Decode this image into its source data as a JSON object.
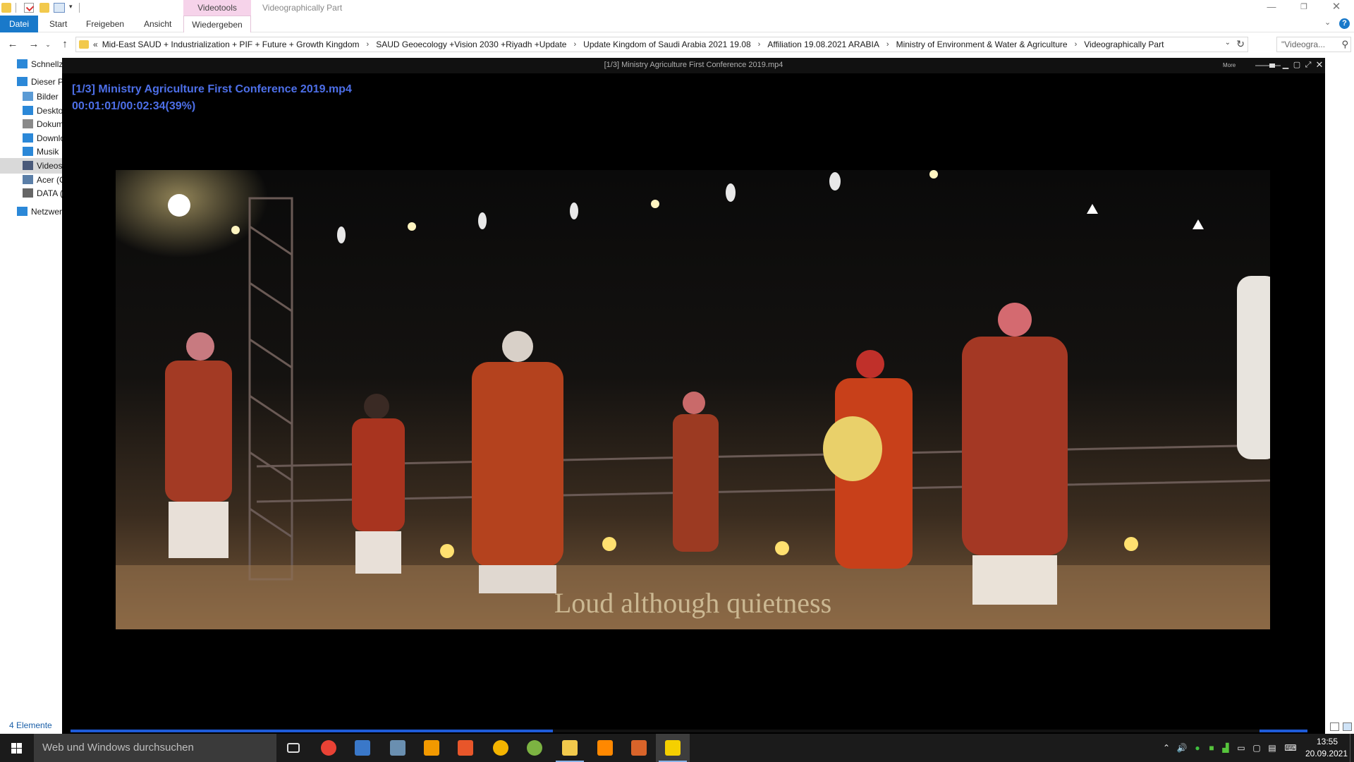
{
  "explorer": {
    "window_title": "Videographically Part",
    "context_tab_header": "Videotools",
    "ribbon_tabs": [
      "Datei",
      "Start",
      "Freigeben",
      "Ansicht",
      "Wiedergeben"
    ],
    "address_overflow": "«",
    "breadcrumbs": [
      "Mid-East SAUD + Industrialization + PIF + Future + Growth Kingdom",
      "SAUD Geoecology +Vision 2030 +Riyadh +Update",
      "Update Kingdom of Saudi Arabia 2021 19.08",
      "Affiliation 19.08.2021 ARABIA",
      "Ministry of Environment &  Water & Agriculture",
      "Videographically Part"
    ],
    "search_placeholder": "\"Videogra...",
    "nav_pane": [
      {
        "label": "Schnellzugriff",
        "icon": "star-icon",
        "color": "#2b88d8"
      },
      {
        "label": "Dieser PC",
        "icon": "computer-icon",
        "color": "#2b88d8"
      },
      {
        "label": "Bilder",
        "icon": "pictures-folder-icon",
        "color": "#5b9bd5"
      },
      {
        "label": "Desktop",
        "icon": "desktop-folder-icon",
        "color": "#2b88d8"
      },
      {
        "label": "Dokumente",
        "icon": "documents-folder-icon",
        "color": "#8a8a8a"
      },
      {
        "label": "Downloads",
        "icon": "downloads-folder-icon",
        "color": "#2b88d8"
      },
      {
        "label": "Musik",
        "icon": "music-folder-icon",
        "color": "#2b88d8"
      },
      {
        "label": "Videos",
        "icon": "videos-folder-icon",
        "color": "#4a5a7a"
      },
      {
        "label": "Acer (C:)",
        "icon": "drive-c-icon",
        "color": "#5b7fa8"
      },
      {
        "label": "DATA (D:)",
        "icon": "drive-d-icon",
        "color": "#666666"
      },
      {
        "label": "Netzwerk",
        "icon": "network-icon",
        "color": "#2b88d8"
      }
    ],
    "status_item_count": "4 Elemente"
  },
  "player": {
    "title": "[1/3] Ministry Agriculture First  Conference 2019.mp4",
    "more_label": "More",
    "osd_file": "[1/3] Ministry Agriculture First  Conference 2019.mp4",
    "osd_time": "00:01:01/00:02:34(39%)",
    "progress_fraction": 0.39,
    "subtitle": "Loud although quietness",
    "accent_color": "#4d6fe8"
  },
  "taskbar": {
    "search_placeholder": "Web und Windows durchsuchen",
    "apps": [
      {
        "name": "task-view-icon",
        "color": "#dddddd"
      },
      {
        "name": "chrome-icon",
        "color": "#e94235"
      },
      {
        "name": "image-viewer-icon",
        "color": "#3a78c9"
      },
      {
        "name": "photo-tool-icon",
        "color": "#6a8fb0"
      },
      {
        "name": "app-orange-icon",
        "color": "#f29900"
      },
      {
        "name": "office-icon",
        "color": "#e8562a"
      },
      {
        "name": "browser-icon",
        "color": "#f4b400"
      },
      {
        "name": "photos-app-icon",
        "color": "#7cb342"
      },
      {
        "name": "file-explorer-icon",
        "color": "#f2c94c"
      },
      {
        "name": "vlc-icon",
        "color": "#ff8800"
      },
      {
        "name": "media-tool-icon",
        "color": "#d9642a"
      },
      {
        "name": "video-player-icon",
        "color": "#f5d000"
      }
    ],
    "clock_time": "13:55",
    "clock_date": "20.09.2021"
  }
}
